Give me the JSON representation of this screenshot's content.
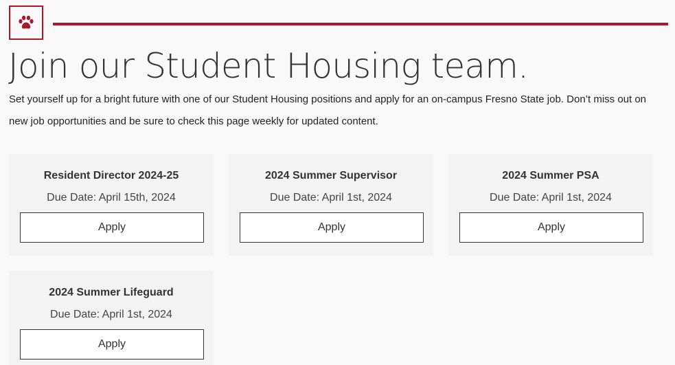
{
  "header": {
    "logo_icon": "paw-icon",
    "accent_color": "#a6192e",
    "title": "Join our Student Housing team.",
    "intro": "Set yourself up for a bright future with one of our Student Housing positions and apply for an on-campus Fresno State job. Don’t miss out on new job opportunities and be sure to check this page weekly for updated content."
  },
  "jobs": [
    {
      "title": "Resident Director 2024-25",
      "due": "Due Date: April 15th, 2024",
      "apply_label": "Apply"
    },
    {
      "title": "2024 Summer Supervisor",
      "due": "Due Date: April 1st, 2024",
      "apply_label": "Apply"
    },
    {
      "title": "2024 Summer PSA",
      "due": "Due Date: April 1st, 2024",
      "apply_label": "Apply"
    },
    {
      "title": "2024 Summer Lifeguard",
      "due": "Due Date: April 1st, 2024",
      "apply_label": "Apply"
    }
  ]
}
